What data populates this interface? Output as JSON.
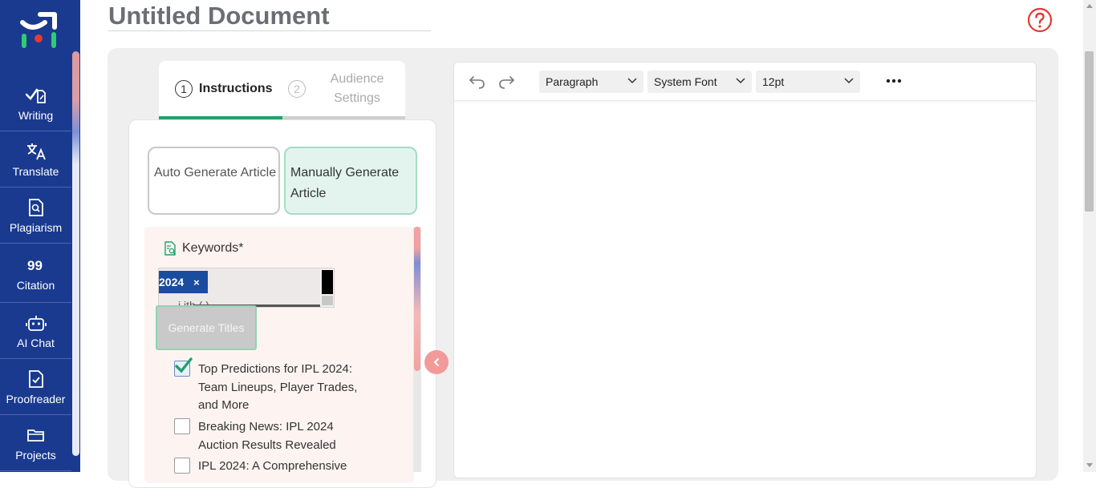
{
  "document": {
    "title": "Untitled Document"
  },
  "sidebar": {
    "items": [
      {
        "label": "Writing",
        "icon": "writing-icon"
      },
      {
        "label": "Translate",
        "icon": "translate-icon"
      },
      {
        "label": "Plagiarism",
        "icon": "plagiarism-icon"
      },
      {
        "label": "Citation",
        "icon": "citation-icon"
      },
      {
        "label": "AI Chat",
        "icon": "ai-chat-icon"
      },
      {
        "label": "Proofreader",
        "icon": "proofreader-icon"
      },
      {
        "label": "Projects",
        "icon": "projects-icon"
      }
    ]
  },
  "tabs": [
    {
      "number": "1",
      "label": "Instructions",
      "active": true
    },
    {
      "number": "2",
      "label": "Audience Settings",
      "active": false
    }
  ],
  "generate_options": {
    "auto": "Auto Generate Article",
    "manual": "Manually Generate Article"
  },
  "keywords": {
    "label": "Keywords*",
    "chip": "2024",
    "chip_remove": "×",
    "partial_text": "i      ith          ( )"
  },
  "generate_titles_button": "Generate Titles",
  "titles": [
    {
      "text": "Top Predictions for IPL 2024: Team Lineups, Player Trades, and More",
      "checked": true
    },
    {
      "text": "Breaking News: IPL 2024 Auction Results Revealed",
      "checked": false
    },
    {
      "text": "IPL 2024: A Comprehensive",
      "checked": false
    }
  ],
  "toolbar": {
    "block_format": "Paragraph",
    "font_family": "System Font",
    "font_size": "12pt"
  },
  "colors": {
    "sidebar_bg": "#1a3a8f",
    "accent_green": "#22a06b",
    "chip_blue": "#1a4d9e",
    "help_red": "#e53935",
    "collapse_pink": "#f29a9a"
  }
}
